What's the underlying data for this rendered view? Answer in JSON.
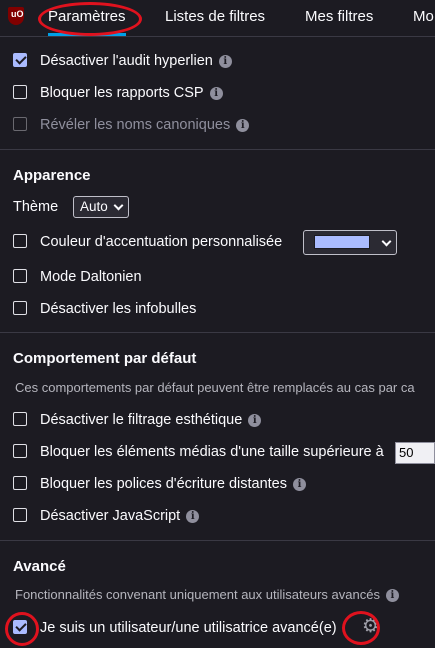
{
  "tabs": [
    {
      "label": "Paramètres"
    },
    {
      "label": "Listes de filtres"
    },
    {
      "label": "Mes filtres"
    },
    {
      "label": "Mo"
    }
  ],
  "privacy": {
    "disable_hyperlink_audit": "Désactiver l'audit hyperlien",
    "block_csp_reports": "Bloquer les rapports CSP",
    "reveal_canonical_names": "Révéler les noms canoniques"
  },
  "appearance": {
    "heading": "Apparence",
    "theme_label": "Thème",
    "theme_value": "Auto",
    "custom_accent": "Couleur d'accentuation personnalisée",
    "accent_color": "#aabbff",
    "colorblind_mode": "Mode Daltonien",
    "disable_tooltips": "Désactiver les infobulles"
  },
  "default_behavior": {
    "heading": "Comportement par défaut",
    "note": "Ces comportements par défaut peuvent être remplacés au cas par ca",
    "disable_cosmetic": "Désactiver le filtrage esthétique",
    "block_large_media": "Bloquer les éléments médias d'une taille supérieure à",
    "large_media_size": "50",
    "block_remote_fonts": "Bloquer les polices d'écriture distantes",
    "disable_javascript": "Désactiver JavaScript"
  },
  "advanced": {
    "heading": "Avancé",
    "note": "Fonctionnalités convenant uniquement aux utilisateurs avancés",
    "advanced_user": "Je suis un utilisateur/une utilisatrice avancé(e)"
  },
  "colors": {
    "background": "#1c1b22",
    "accent": "#00a0e6",
    "highlight_ring": "#e0121e",
    "checkbox_checked": "#aabbff"
  }
}
